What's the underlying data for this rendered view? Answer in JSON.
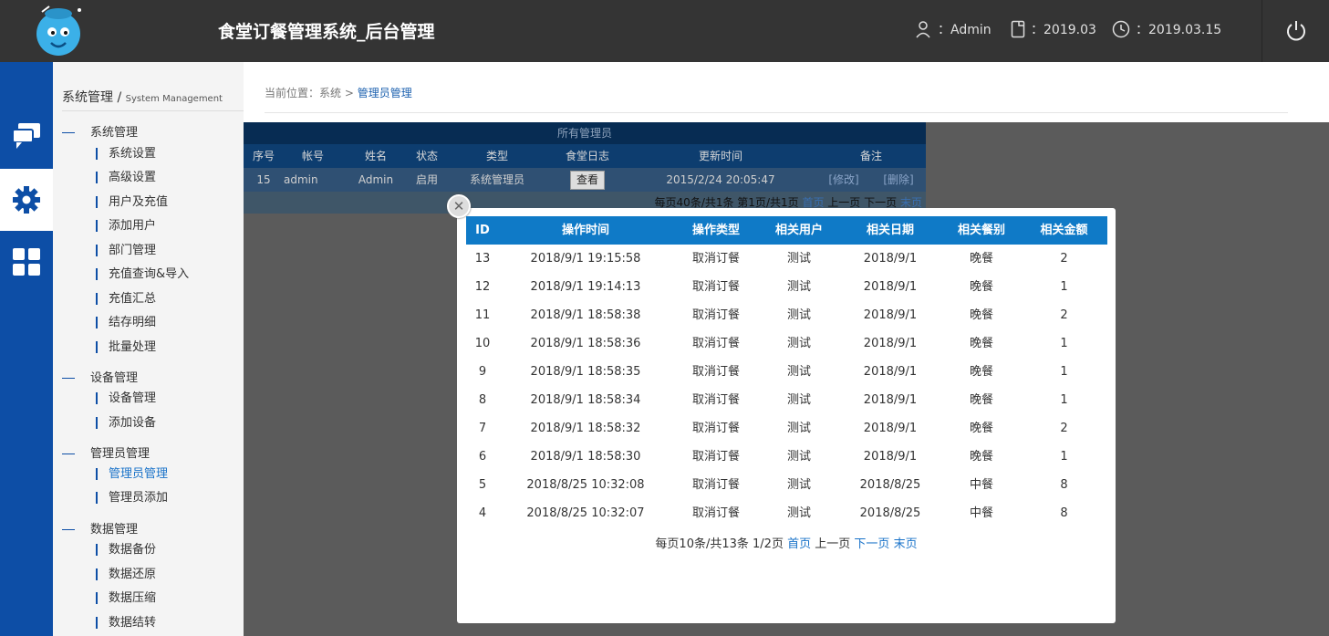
{
  "header": {
    "title": "食堂订餐管理系统_后台管理",
    "user": "：Admin",
    "month": "：2019.03",
    "date": "：2019.03.15"
  },
  "sidebar": {
    "title": "系统管理",
    "title_sep": "/",
    "subtitle": "System Management",
    "groups": [
      {
        "label": "系统管理",
        "items": [
          "系统设置",
          "高级设置",
          "用户及充值",
          "添加用户",
          "部门管理",
          "充值查询&导入",
          "充值汇总",
          "结存明细",
          "批量处理"
        ]
      },
      {
        "label": "设备管理",
        "items": [
          "设备管理",
          "添加设备"
        ]
      },
      {
        "label": "管理员管理",
        "items": [
          "管理员管理",
          "管理员添加"
        ]
      },
      {
        "label": "数据管理",
        "items": [
          "数据备份",
          "数据还原",
          "数据压缩",
          "数据结转"
        ]
      }
    ],
    "active_item": "管理员管理"
  },
  "breadcrumb": {
    "prefix": "当前位置：系统",
    "sep": ">",
    "current": "管理员管理"
  },
  "admin_table": {
    "title": "所有管理员",
    "headers": [
      "序号",
      "帐号",
      "姓名",
      "状态",
      "类型",
      "食堂日志",
      "更新时间",
      "备注"
    ],
    "row": {
      "no": "15",
      "account": "admin",
      "name": "Admin",
      "status": "启用",
      "type": "系统管理员",
      "view": "查看",
      "updated": "2015/2/24 20:05:47",
      "edit": "[修改]",
      "delete": "[删除]"
    },
    "pager": {
      "info": "每页40条/共1条 第1页/共1页",
      "first": "首页",
      "prev": "上一页",
      "next": "下一页",
      "last": "末页"
    }
  },
  "log_modal": {
    "close_icon": "close-x",
    "headers": [
      "ID",
      "操作时间",
      "操作类型",
      "相关用户",
      "相关日期",
      "相关餐别",
      "相关金额"
    ],
    "rows": [
      {
        "id": "13",
        "time": "2018/9/1 19:15:58",
        "type": "取消订餐",
        "user": "测试",
        "date": "2018/9/1",
        "meal": "晚餐",
        "amount": "2"
      },
      {
        "id": "12",
        "time": "2018/9/1 19:14:13",
        "type": "取消订餐",
        "user": "测试",
        "date": "2018/9/1",
        "meal": "晚餐",
        "amount": "1"
      },
      {
        "id": "11",
        "time": "2018/9/1 18:58:38",
        "type": "取消订餐",
        "user": "测试",
        "date": "2018/9/1",
        "meal": "晚餐",
        "amount": "2"
      },
      {
        "id": "10",
        "time": "2018/9/1 18:58:36",
        "type": "取消订餐",
        "user": "测试",
        "date": "2018/9/1",
        "meal": "晚餐",
        "amount": "1"
      },
      {
        "id": "9",
        "time": "2018/9/1 18:58:35",
        "type": "取消订餐",
        "user": "测试",
        "date": "2018/9/1",
        "meal": "晚餐",
        "amount": "1"
      },
      {
        "id": "8",
        "time": "2018/9/1 18:58:34",
        "type": "取消订餐",
        "user": "测试",
        "date": "2018/9/1",
        "meal": "晚餐",
        "amount": "1"
      },
      {
        "id": "7",
        "time": "2018/9/1 18:58:32",
        "type": "取消订餐",
        "user": "测试",
        "date": "2018/9/1",
        "meal": "晚餐",
        "amount": "2"
      },
      {
        "id": "6",
        "time": "2018/9/1 18:58:30",
        "type": "取消订餐",
        "user": "测试",
        "date": "2018/9/1",
        "meal": "晚餐",
        "amount": "1"
      },
      {
        "id": "5",
        "time": "2018/8/25 10:32:08",
        "type": "取消订餐",
        "user": "测试",
        "date": "2018/8/25",
        "meal": "中餐",
        "amount": "8"
      },
      {
        "id": "4",
        "time": "2018/8/25 10:32:07",
        "type": "取消订餐",
        "user": "测试",
        "date": "2018/8/25",
        "meal": "中餐",
        "amount": "8"
      }
    ],
    "pager": {
      "info": "每页10条/共13条 1/2页",
      "first": "首页",
      "prev": "上一页",
      "next": "下一页",
      "last": "末页"
    }
  },
  "colors": {
    "topbar": "#343434",
    "nav": "#0d4ea6",
    "accent": "#0f7ac7",
    "link": "#1a73c9"
  }
}
